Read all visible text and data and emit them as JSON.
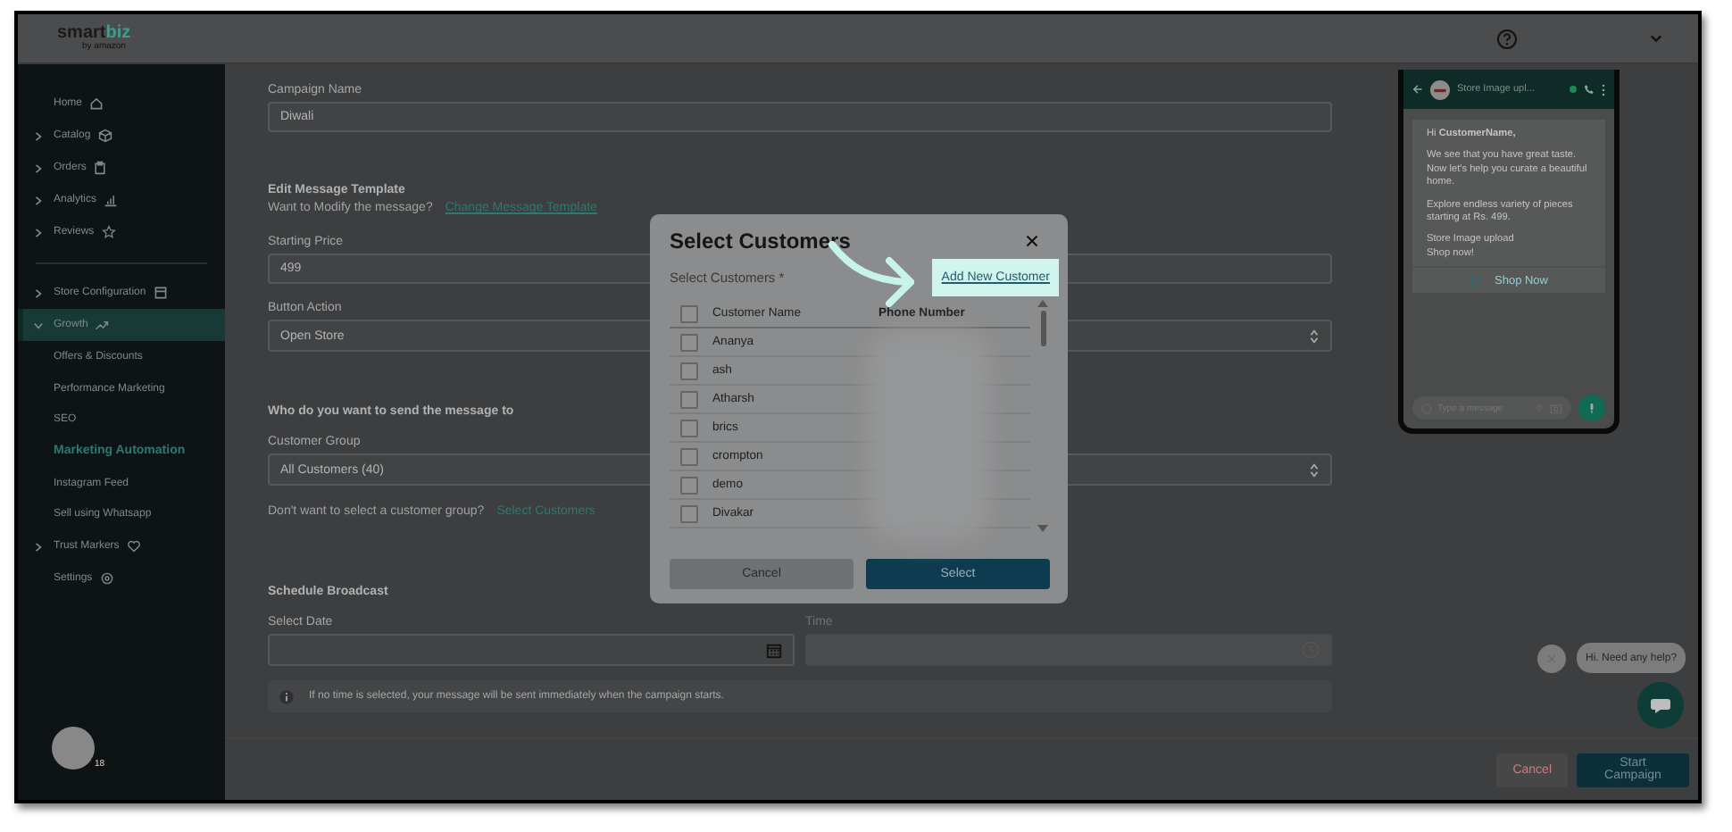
{
  "header": {
    "logo": {
      "name": "smart",
      "accent": "biz",
      "tagline": "by amazon"
    }
  },
  "sidebar": {
    "groups": [
      [
        {
          "label": "Home",
          "kind": "home",
          "has_children": false,
          "selected": false
        },
        {
          "label": "Catalog",
          "kind": "box",
          "has_children": true,
          "expanded": false,
          "selected": false
        },
        {
          "label": "Orders",
          "kind": "clipboard",
          "has_children": true,
          "expanded": false,
          "selected": false
        },
        {
          "label": "Analytics",
          "kind": "chart",
          "has_children": true,
          "expanded": false,
          "selected": false
        },
        {
          "label": "Reviews",
          "kind": "star",
          "has_children": true,
          "expanded": false,
          "selected": false
        }
      ],
      [
        {
          "label": "Store Configuration",
          "kind": "store",
          "has_children": true,
          "expanded": false,
          "selected": false
        },
        {
          "label": "Growth",
          "kind": "trend",
          "has_children": true,
          "expanded": true,
          "selected": true,
          "children": [
            {
              "label": "Offers & Discounts",
              "selected": false
            },
            {
              "label": "Performance Marketing",
              "selected": false
            },
            {
              "label": "SEO",
              "selected": false
            },
            {
              "label": "Marketing Automation",
              "selected": true
            },
            {
              "label": "Instagram Feed",
              "selected": false
            },
            {
              "label": "Sell using Whatsapp",
              "selected": false
            }
          ]
        },
        {
          "label": "Trust Markers",
          "kind": "heart",
          "has_children": true,
          "expanded": false,
          "selected": false
        },
        {
          "label": "Settings",
          "kind": "gear",
          "has_children": false,
          "selected": false
        }
      ]
    ],
    "avatar": {
      "badge": "18"
    }
  },
  "form": {
    "campaign_name": {
      "label": "Campaign Name",
      "value": "Diwali"
    },
    "template": {
      "title": "Edit Message Template",
      "prompt": "Want to Modify the message?",
      "link": "Change Message Template"
    },
    "starting_price": {
      "label": "Starting Price",
      "value": "499"
    },
    "button_action": {
      "label": "Button Action",
      "value": "Open Store"
    },
    "audience": {
      "title": "Who do you want to send the message to",
      "group_label": "Customer Group",
      "group_value": "All Customers (40)",
      "prompt": "Don't want to select a customer group?",
      "link": "Select Customers"
    },
    "schedule": {
      "title": "Schedule Broadcast",
      "date_label": "Select Date",
      "time_label": "Time",
      "time_disabled": true,
      "info": "If no time is selected, your message will be sent immediately when the campaign starts."
    }
  },
  "actions": {
    "cancel": "Cancel",
    "submit": "Start Campaign"
  },
  "preview": {
    "contact": "Store Image upl...",
    "greeting": "Hi **CustomerName,**",
    "paragraphs": [
      [
        "We see that you have great taste. Now let's help you curate a beautiful home."
      ],
      [
        "Explore endless variety of pieces starting at Rs. 499."
      ],
      [
        "Store Image upload",
        "Shop now!"
      ]
    ],
    "button": "Shop Now",
    "input_placeholder": "Type a message"
  },
  "modal": {
    "title": "Select Customers",
    "field_label": "Select Customers *",
    "add_link": "Add New Customer",
    "columns": [
      "Customer Name",
      "Phone Number"
    ],
    "select_all": false,
    "rows": [
      {
        "name": "Ananya",
        "checked": false
      },
      {
        "name": "ash",
        "checked": false
      },
      {
        "name": "Atharsh",
        "checked": false
      },
      {
        "name": "brics",
        "checked": false
      },
      {
        "name": "crompton",
        "checked": false
      },
      {
        "name": "demo",
        "checked": false
      },
      {
        "name": "Divakar",
        "checked": false
      }
    ],
    "cancel": "Cancel",
    "confirm": "Select"
  },
  "chat_widget": {
    "greeting": "Hi. Need any help?"
  }
}
